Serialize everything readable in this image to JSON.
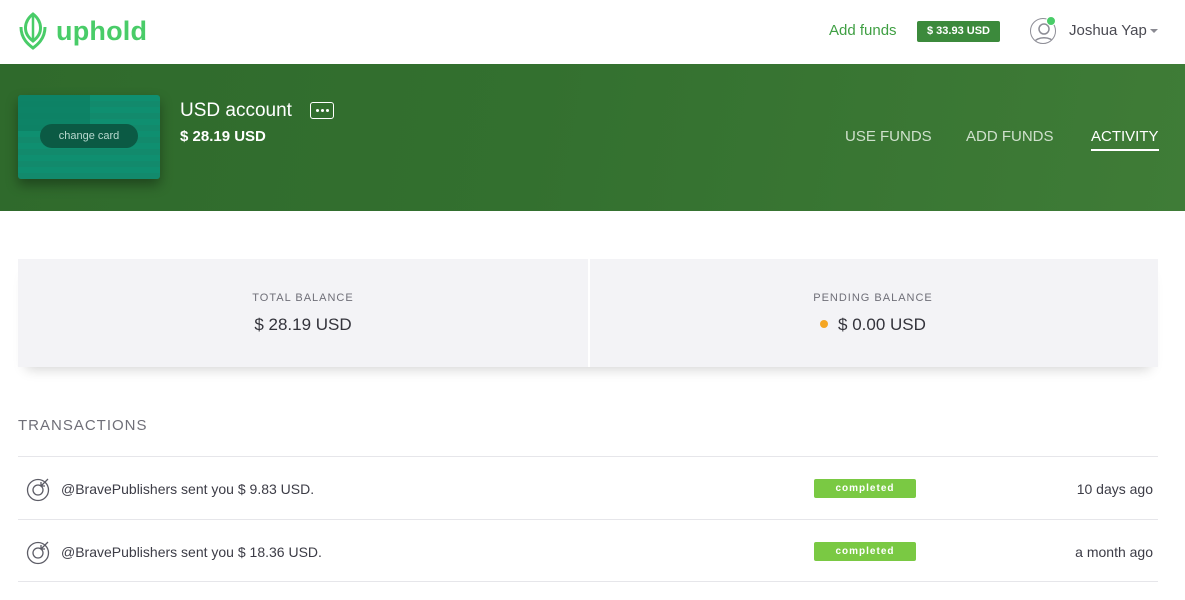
{
  "brand": {
    "name": "uphold",
    "color": "#49cc68"
  },
  "topnav": {
    "add_funds": "Add funds",
    "total_badge": "$ 33.93 USD",
    "user_name": "Joshua Yap"
  },
  "account": {
    "card_button": "change card",
    "name": "USD account",
    "balance": "$ 28.19 USD",
    "tabs": [
      {
        "label": "USE FUNDS",
        "active": false
      },
      {
        "label": "ADD FUNDS",
        "active": false
      },
      {
        "label": "ACTIVITY",
        "active": true
      }
    ]
  },
  "balances": {
    "total": {
      "label": "TOTAL BALANCE",
      "value": "$ 28.19 USD"
    },
    "pending": {
      "label": "PENDING BALANCE",
      "value": "$ 0.00 USD",
      "dot_color": "#f5a623"
    }
  },
  "transactions": {
    "title": "TRANSACTIONS",
    "rows": [
      {
        "text": "@BravePublishers sent you $ 9.83 USD.",
        "status": "completed",
        "time": "10 days ago"
      },
      {
        "text": "@BravePublishers sent you $ 18.36 USD.",
        "status": "completed",
        "time": "a month ago"
      }
    ]
  }
}
